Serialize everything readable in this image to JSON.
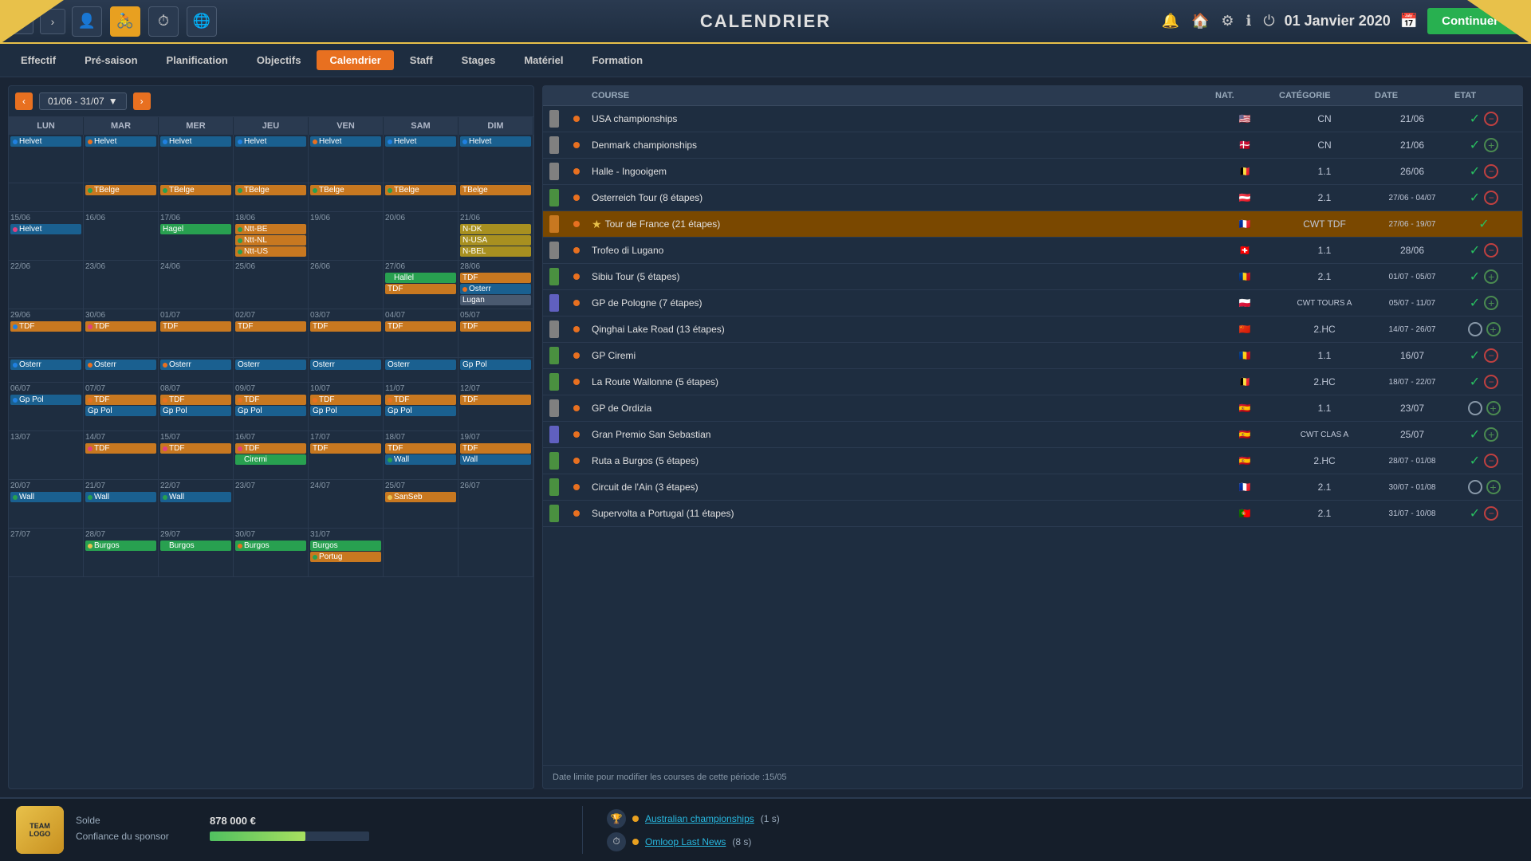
{
  "topBar": {
    "title": "CALENDRIER",
    "date": "01 Janvier 2020",
    "continueLabel": "Continuer"
  },
  "navTabs": {
    "tabs": [
      {
        "label": "Effectif",
        "active": false
      },
      {
        "label": "Pré-saison",
        "active": false
      },
      {
        "label": "Planification",
        "active": false
      },
      {
        "label": "Objectifs",
        "active": false
      },
      {
        "label": "Calendrier",
        "active": true
      },
      {
        "label": "Staff",
        "active": false
      },
      {
        "label": "Stages",
        "active": false
      },
      {
        "label": "Matériel",
        "active": false
      },
      {
        "label": "Formation",
        "active": false
      }
    ]
  },
  "calendar": {
    "period": "01/06 - 31/07",
    "dayHeaders": [
      "LUN",
      "MAR",
      "MER",
      "JEU",
      "VEN",
      "SAM",
      "DIM"
    ],
    "weeks": [
      {
        "cells": [
          {
            "date": "",
            "events": [
              {
                "label": "Helvet",
                "color": "blue",
                "dot": "blue"
              }
            ]
          },
          {
            "date": "",
            "events": [
              {
                "label": "Helvet",
                "color": "blue",
                "dot": "orange"
              }
            ]
          },
          {
            "date": "",
            "events": [
              {
                "label": "Helvet",
                "color": "blue",
                "dot": "blue"
              }
            ]
          },
          {
            "date": "",
            "events": [
              {
                "label": "Helvet",
                "color": "blue",
                "dot": "blue"
              }
            ]
          },
          {
            "date": "",
            "events": [
              {
                "label": "Helvet",
                "color": "blue",
                "dot": "orange"
              }
            ]
          },
          {
            "date": "",
            "events": [
              {
                "label": "Helvet",
                "color": "blue",
                "dot": "blue"
              }
            ]
          },
          {
            "date": "",
            "events": [
              {
                "label": "Helvet",
                "color": "blue",
                "dot": "blue"
              }
            ]
          }
        ]
      },
      {
        "cells": [
          {
            "date": "",
            "events": []
          },
          {
            "date": "",
            "events": [
              {
                "label": "TBelge",
                "color": "orange"
              }
            ]
          },
          {
            "date": "",
            "events": [
              {
                "label": "TBelge",
                "color": "orange"
              }
            ]
          },
          {
            "date": "",
            "events": [
              {
                "label": "TBelge",
                "color": "orange"
              }
            ]
          },
          {
            "date": "",
            "events": [
              {
                "label": "TBelge",
                "color": "orange"
              }
            ]
          },
          {
            "date": "",
            "events": [
              {
                "label": "TBelge",
                "color": "orange"
              }
            ]
          },
          {
            "date": "",
            "events": [
              {
                "label": "TBelge",
                "color": "orange"
              }
            ]
          }
        ]
      },
      {
        "cells": [
          {
            "date": "15/06",
            "events": [
              {
                "label": "Helvet",
                "color": "blue"
              }
            ]
          },
          {
            "date": "16/06",
            "events": []
          },
          {
            "date": "17/06",
            "events": [
              {
                "label": "Hagel",
                "color": "green"
              }
            ]
          },
          {
            "date": "18/06",
            "events": [
              {
                "label": "Ntt-BE",
                "color": "orange"
              },
              {
                "label": "Ntt-NL",
                "color": "orange"
              },
              {
                "label": "Ntt-US",
                "color": "orange"
              }
            ]
          },
          {
            "date": "19/06",
            "events": []
          },
          {
            "date": "20/06",
            "events": []
          },
          {
            "date": "21/06",
            "events": [
              {
                "label": "N-DK",
                "color": "yellow"
              },
              {
                "label": "N-USA",
                "color": "yellow"
              },
              {
                "label": "N-BEL",
                "color": "yellow"
              }
            ]
          }
        ]
      },
      {
        "cells": [
          {
            "date": "22/06",
            "events": []
          },
          {
            "date": "23/06",
            "events": []
          },
          {
            "date": "24/06",
            "events": []
          },
          {
            "date": "25/06",
            "events": []
          },
          {
            "date": "26/06",
            "events": []
          },
          {
            "date": "27/06",
            "events": [
              {
                "label": "Hallel",
                "color": "green"
              },
              {
                "label": "TDF",
                "color": "orange"
              }
            ]
          },
          {
            "date": "28/06",
            "events": [
              {
                "label": "TDF",
                "color": "orange"
              },
              {
                "label": "Osterr",
                "color": "orange"
              },
              {
                "label": "Lugan",
                "color": "grey"
              }
            ]
          }
        ]
      },
      {
        "cells": [
          {
            "date": "29/06",
            "events": [
              {
                "label": "TDF",
                "color": "orange"
              }
            ]
          },
          {
            "date": "30/06",
            "events": [
              {
                "label": "TDF",
                "color": "orange"
              }
            ]
          },
          {
            "date": "01/07",
            "events": [
              {
                "label": "TDF",
                "color": "orange"
              }
            ]
          },
          {
            "date": "02/07",
            "events": [
              {
                "label": "TDF",
                "color": "orange"
              }
            ]
          },
          {
            "date": "03/07",
            "events": [
              {
                "label": "TDF",
                "color": "orange"
              }
            ]
          },
          {
            "date": "04/07",
            "events": [
              {
                "label": "TDF",
                "color": "orange"
              }
            ]
          },
          {
            "date": "05/07",
            "events": [
              {
                "label": "TDF",
                "color": "orange"
              }
            ]
          }
        ]
      },
      {
        "cells": [
          {
            "date": "",
            "events": [
              {
                "label": "Osterr",
                "color": "blue"
              }
            ]
          },
          {
            "date": "",
            "events": [
              {
                "label": "Osterr",
                "color": "blue"
              }
            ]
          },
          {
            "date": "",
            "events": [
              {
                "label": "Osterr",
                "color": "blue"
              }
            ]
          },
          {
            "date": "",
            "events": [
              {
                "label": "Osterr",
                "color": "blue"
              }
            ]
          },
          {
            "date": "",
            "events": [
              {
                "label": "Osterr",
                "color": "blue"
              }
            ]
          },
          {
            "date": "",
            "events": [
              {
                "label": "Osterr",
                "color": "blue"
              }
            ]
          },
          {
            "date": "",
            "events": [
              {
                "label": "Gp Pol",
                "color": "blue"
              }
            ]
          }
        ]
      },
      {
        "cells": [
          {
            "date": "06/07",
            "events": [
              {
                "label": "Gp Pol",
                "color": "blue"
              }
            ]
          },
          {
            "date": "07/07",
            "events": [
              {
                "label": "TDF",
                "color": "orange"
              },
              {
                "label": "Gp Pol",
                "color": "blue"
              }
            ]
          },
          {
            "date": "08/07",
            "events": [
              {
                "label": "TDF",
                "color": "orange"
              },
              {
                "label": "Gp Pol",
                "color": "blue"
              }
            ]
          },
          {
            "date": "09/07",
            "events": [
              {
                "label": "TDF",
                "color": "orange"
              },
              {
                "label": "Gp Pol",
                "color": "blue"
              }
            ]
          },
          {
            "date": "10/07",
            "events": [
              {
                "label": "TDF",
                "color": "orange"
              },
              {
                "label": "Gp Pol",
                "color": "blue"
              }
            ]
          },
          {
            "date": "11/07",
            "events": [
              {
                "label": "TDF",
                "color": "orange"
              },
              {
                "label": "Gp Pol",
                "color": "blue"
              }
            ]
          },
          {
            "date": "12/07",
            "events": [
              {
                "label": "TDF",
                "color": "orange"
              }
            ]
          }
        ]
      },
      {
        "cells": [
          {
            "date": "13/07",
            "events": []
          },
          {
            "date": "14/07",
            "events": [
              {
                "label": "TDF",
                "color": "orange"
              }
            ]
          },
          {
            "date": "15/07",
            "events": [
              {
                "label": "TDF",
                "color": "orange"
              }
            ]
          },
          {
            "date": "16/07",
            "events": [
              {
                "label": "TDF",
                "color": "orange"
              },
              {
                "label": "Ciremi",
                "color": "green"
              }
            ]
          },
          {
            "date": "17/07",
            "events": [
              {
                "label": "TDF",
                "color": "orange"
              }
            ]
          },
          {
            "date": "18/07",
            "events": [
              {
                "label": "TDF",
                "color": "orange"
              },
              {
                "label": "Wall",
                "color": "blue"
              }
            ]
          },
          {
            "date": "19/07",
            "events": [
              {
                "label": "TDF",
                "color": "orange"
              },
              {
                "label": "Wall",
                "color": "blue"
              }
            ]
          }
        ]
      },
      {
        "cells": [
          {
            "date": "20/07",
            "events": [
              {
                "label": "Wall",
                "color": "blue"
              }
            ]
          },
          {
            "date": "21/07",
            "events": [
              {
                "label": "Wall",
                "color": "blue"
              }
            ]
          },
          {
            "date": "22/07",
            "events": [
              {
                "label": "Wall",
                "color": "blue"
              }
            ]
          },
          {
            "date": "23/07",
            "events": []
          },
          {
            "date": "24/07",
            "events": []
          },
          {
            "date": "25/07",
            "events": [
              {
                "label": "SanSeb",
                "color": "orange"
              }
            ]
          },
          {
            "date": "26/07",
            "events": []
          }
        ]
      },
      {
        "cells": [
          {
            "date": "27/07",
            "events": []
          },
          {
            "date": "28/07",
            "events": [
              {
                "label": "Burgos",
                "color": "green"
              }
            ]
          },
          {
            "date": "29/07",
            "events": [
              {
                "label": "Burgos",
                "color": "green"
              }
            ]
          },
          {
            "date": "30/07",
            "events": [
              {
                "label": "Burgos",
                "color": "green"
              }
            ]
          },
          {
            "date": "31/07",
            "events": [
              {
                "label": "Burgos",
                "color": "green"
              },
              {
                "label": "Portug",
                "color": "orange"
              }
            ]
          },
          {
            "date": "",
            "events": []
          },
          {
            "date": "",
            "events": []
          }
        ]
      }
    ]
  },
  "raceList": {
    "headers": [
      "",
      "",
      "COURSE",
      "NAT.",
      "CATÉGORIE",
      "DATE",
      "ETAT"
    ],
    "races": [
      {
        "color": "#808080",
        "dot": "orange",
        "name": "USA championships",
        "nat": "🇺🇸",
        "category": "CN",
        "date": "21/06",
        "check": true,
        "minus": true,
        "highlighted": false
      },
      {
        "color": "#808080",
        "dot": "orange",
        "name": "Denmark championships",
        "nat": "🇩🇰",
        "category": "CN",
        "date": "21/06",
        "check": true,
        "plus": true,
        "highlighted": false
      },
      {
        "color": "#808080",
        "dot": "orange",
        "name": "Halle - Ingooigem",
        "nat": "🇧🇪",
        "category": "1.1",
        "date": "26/06",
        "check": true,
        "minus": true,
        "highlighted": false
      },
      {
        "color": "#4a9040",
        "dot": "orange",
        "name": "Osterreich Tour (8 étapes)",
        "nat": "🇦🇹",
        "category": "2.1",
        "date": "27/06 - 04/07",
        "check": true,
        "minus": true,
        "highlighted": false
      },
      {
        "color": "#c87820",
        "dot": "orange",
        "name": "Tour de France (21 étapes)",
        "nat": "🇫🇷",
        "category": "CWT TDF",
        "date": "27/06 - 19/07",
        "check": true,
        "star": true,
        "highlighted": true
      },
      {
        "color": "#808080",
        "dot": "orange",
        "name": "Trofeo di Lugano",
        "nat": "🇨🇭",
        "category": "1.1",
        "date": "28/06",
        "check": true,
        "minus": true,
        "highlighted": false
      },
      {
        "color": "#4a9040",
        "dot": "orange",
        "name": "Sibiu Tour (5 étapes)",
        "nat": "🇷🇴",
        "category": "2.1",
        "date": "01/07 - 05/07",
        "check": true,
        "plus": true,
        "highlighted": false
      },
      {
        "color": "#6060c0",
        "dot": "orange",
        "name": "GP de Pologne (7 étapes)",
        "nat": "🇵🇱",
        "category": "CWT TOURS A",
        "date": "05/07 - 11/07",
        "check": true,
        "plus": true,
        "highlighted": false
      },
      {
        "color": "#808080",
        "dot": "orange",
        "name": "Qinghai Lake Road (13 étapes)",
        "nat": "🇨🇳",
        "category": "2.HC",
        "date": "14/07 - 26/07",
        "circle": true,
        "plus": true,
        "highlighted": false
      },
      {
        "color": "#4a9040",
        "dot": "orange",
        "name": "GP Ciremi",
        "nat": "🇷🇴",
        "category": "1.1",
        "date": "16/07",
        "check": true,
        "minus": true,
        "highlighted": false
      },
      {
        "color": "#4a9040",
        "dot": "orange",
        "name": "La Route Wallonne (5 étapes)",
        "nat": "🇧🇪",
        "category": "2.HC",
        "date": "18/07 - 22/07",
        "check": true,
        "minus": true,
        "highlighted": false
      },
      {
        "color": "#808080",
        "dot": "orange",
        "name": "GP de Ordizia",
        "nat": "🇪🇸",
        "category": "1.1",
        "date": "23/07",
        "circle": true,
        "plus": true,
        "highlighted": false
      },
      {
        "color": "#6060c0",
        "dot": "orange",
        "name": "Gran Premio San Sebastian",
        "nat": "🇪🇸",
        "category": "CWT CLAS A",
        "date": "25/07",
        "check": true,
        "plus": true,
        "highlighted": false
      },
      {
        "color": "#4a9040",
        "dot": "orange",
        "name": "Ruta a Burgos (5 étapes)",
        "nat": "🇪🇸",
        "category": "2.HC",
        "date": "28/07 - 01/08",
        "check": true,
        "minus": true,
        "highlighted": false
      },
      {
        "color": "#4a9040",
        "dot": "orange",
        "name": "Circuit de l'Ain (3 étapes)",
        "nat": "🇫🇷",
        "category": "2.1",
        "date": "30/07 - 01/08",
        "circle": true,
        "plus": true,
        "highlighted": false
      },
      {
        "color": "#4a9040",
        "dot": "orange",
        "name": "Supervolta a Portugal (11 étapes)",
        "nat": "🇵🇹",
        "category": "2.1",
        "date": "31/07 - 10/08",
        "check": true,
        "minus": true,
        "highlighted": false
      }
    ],
    "footerText": "Date limite pour modifier les courses de cette période :15/05"
  },
  "bottomBar": {
    "soldeLabel": "Solde",
    "soldeValue": "878 000 €",
    "sponsorLabel": "Confiance du sponsor",
    "sponsorProgress": 60,
    "notifications": [
      {
        "icon": "🏆",
        "text": "Australian championships",
        "suffix": "(1 s)"
      },
      {
        "icon": "⏱",
        "text": "Omloop Last News",
        "suffix": "(8 s)"
      }
    ]
  }
}
